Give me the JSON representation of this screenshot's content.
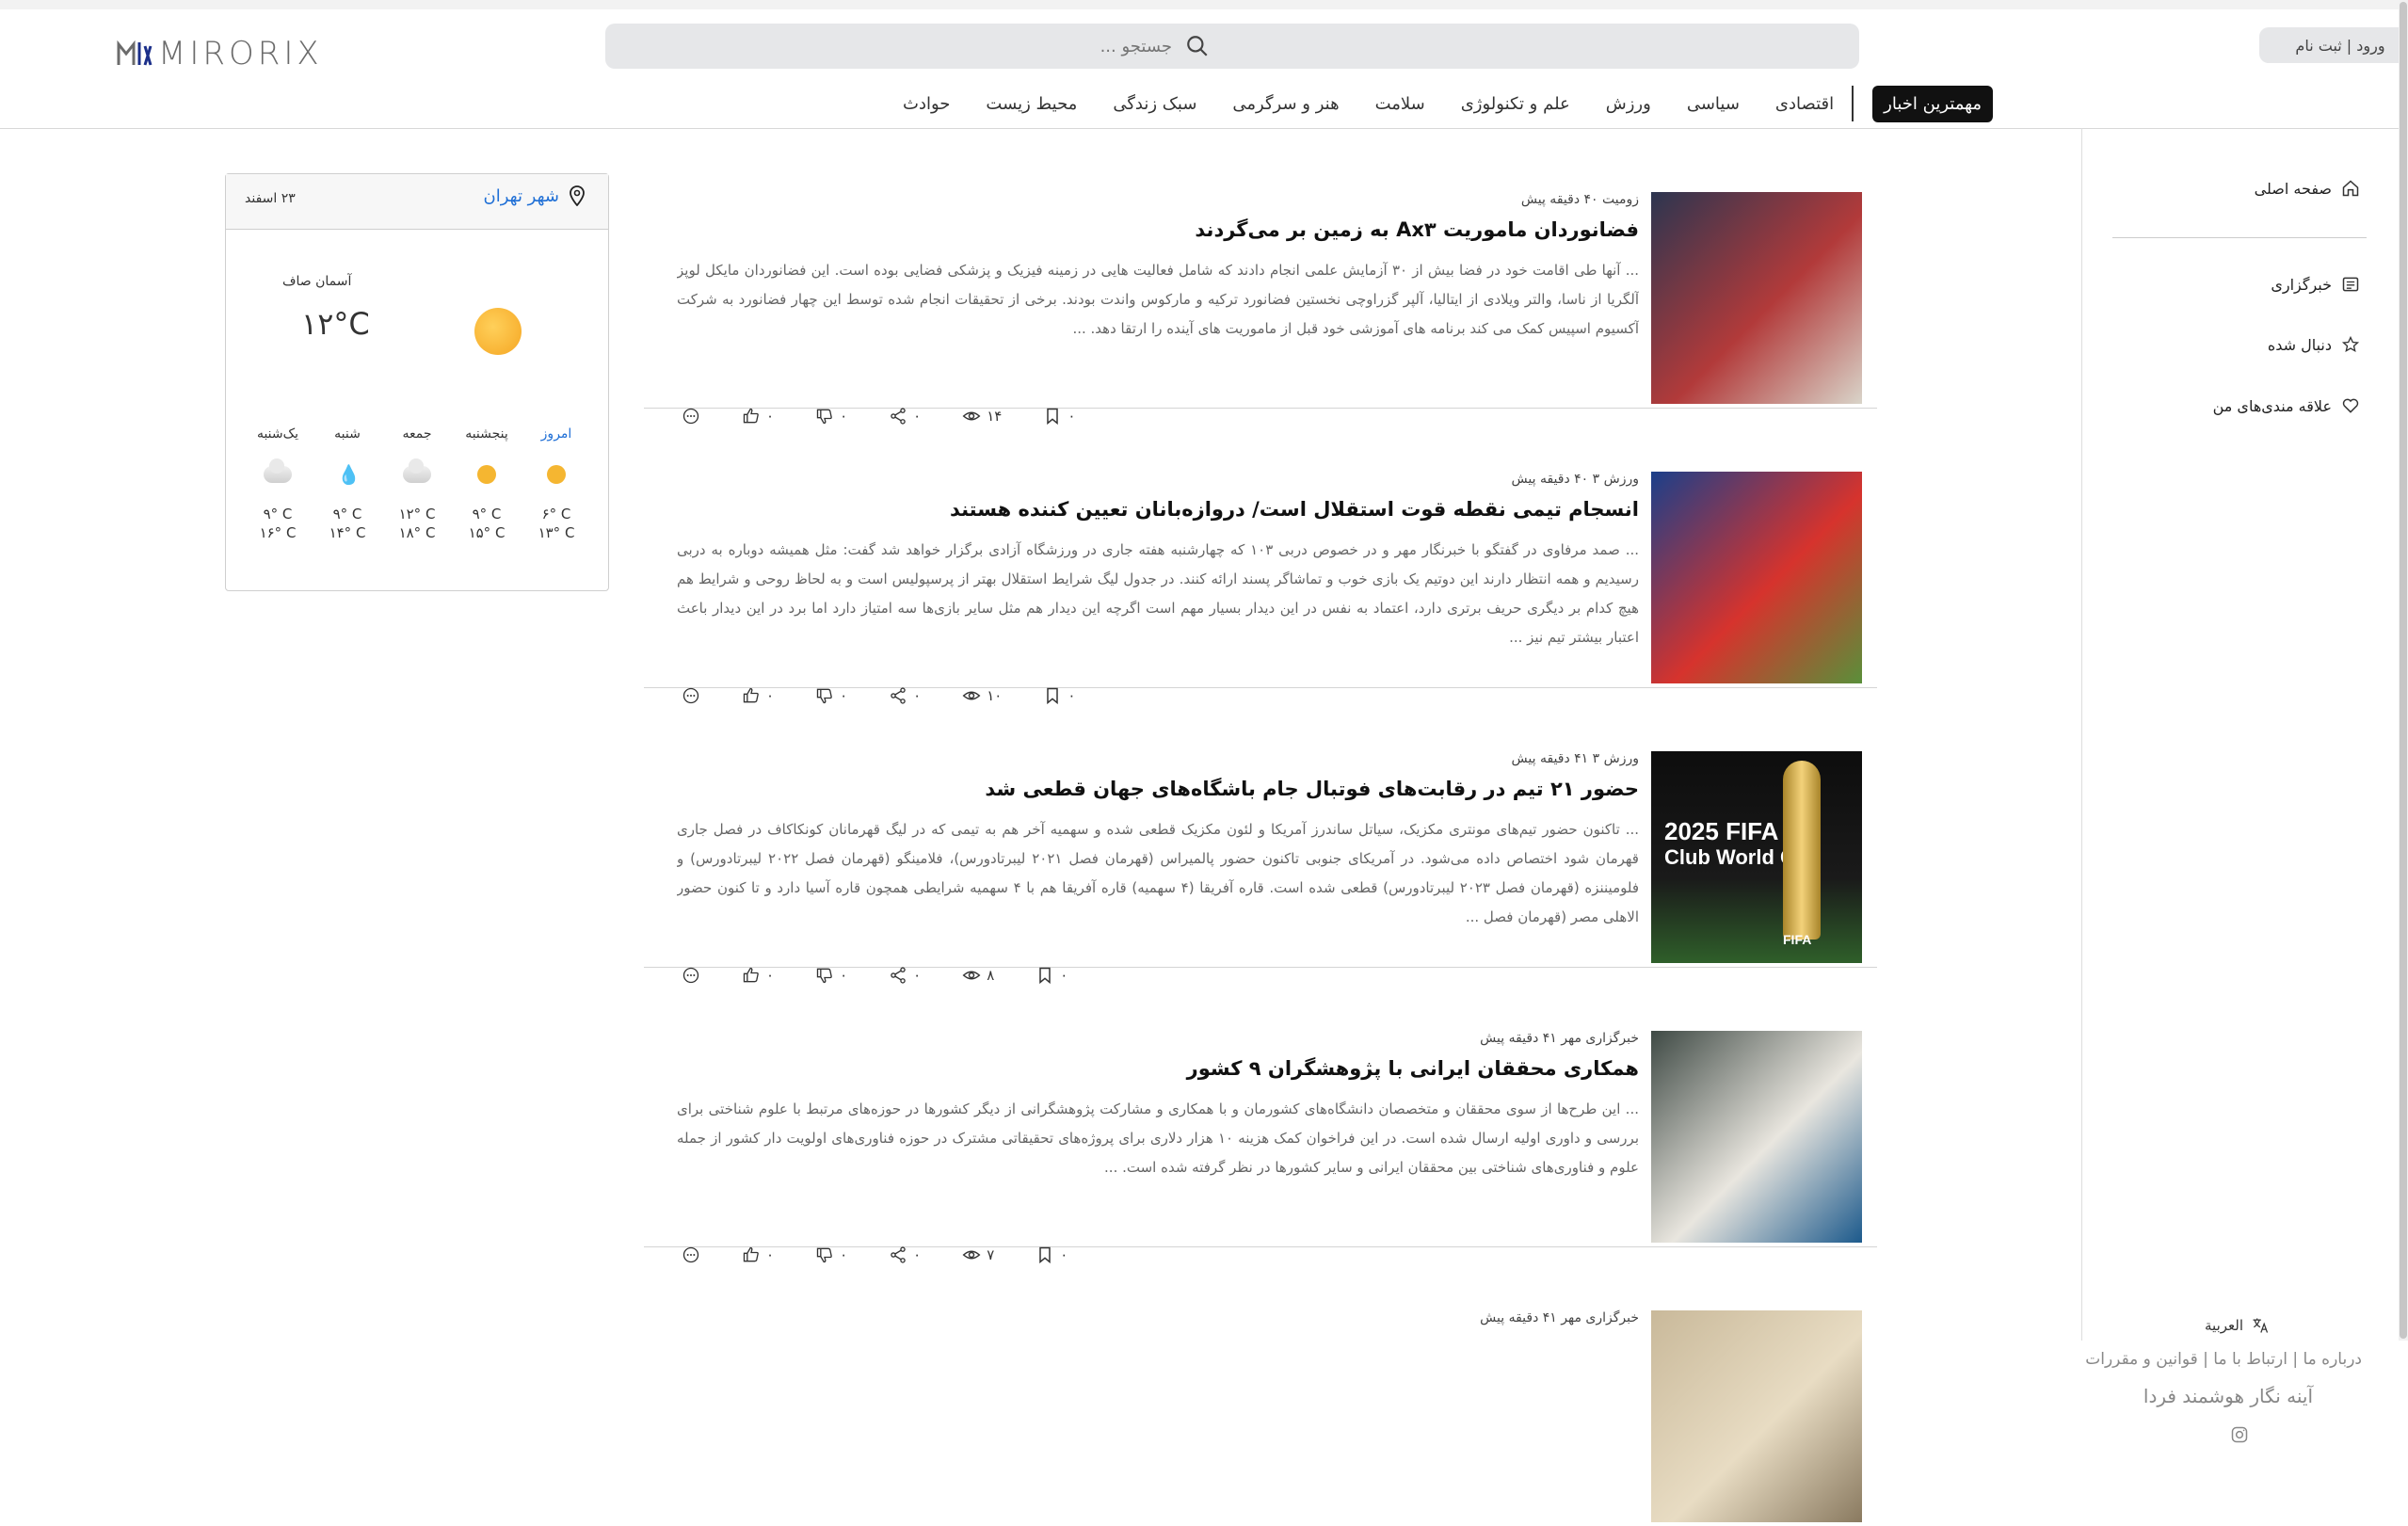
{
  "header": {
    "logo_text": "MIRORIX",
    "search_placeholder": "جستجو ...",
    "login_label": "ورود | ثبت نام",
    "nav": [
      {
        "label": "مهمترین اخبار",
        "active": true
      },
      {
        "label": "اقتصادی"
      },
      {
        "label": "سیاسی"
      },
      {
        "label": "ورزش"
      },
      {
        "label": "علم و تکنولوژی"
      },
      {
        "label": "سلامت"
      },
      {
        "label": "هنر و سرگرمی"
      },
      {
        "label": "سبک زندگی"
      },
      {
        "label": "محیط زیست"
      },
      {
        "label": "حوادث"
      }
    ]
  },
  "sidebar": {
    "home": "صفحه اصلی",
    "agency": "خبرگزاری",
    "followed": "دنبال شده",
    "favorites": "علاقه مندی‌های من",
    "lang": "العربية",
    "links": "درباره ما | ارتباط با ما | قوانین و مقررات",
    "brand": "آینه نگار هوشمند فردا"
  },
  "weather": {
    "city": "شهر تهران",
    "date": "۲۳ اسفند",
    "condition": "آسمان صاف",
    "temp": "۱۲°C",
    "forecast": [
      {
        "day": "امروز",
        "icon": "sun-icon",
        "max": "۶° C",
        "min": "۱۳° C"
      },
      {
        "day": "پنجشنبه",
        "icon": "sun-icon",
        "max": "۹° C",
        "min": "۱۵° C"
      },
      {
        "day": "جمعه",
        "icon": "cloud-icon",
        "max": "۱۲° C",
        "min": "۱۸° C"
      },
      {
        "day": "شنبه",
        "icon": "rain-icon",
        "max": "۹° C",
        "min": "۱۴° C"
      },
      {
        "day": "یک‌شنبه",
        "icon": "cloud-icon",
        "max": "۹° C",
        "min": "۱۶° C"
      }
    ]
  },
  "articles": [
    {
      "meta": "زومیت ۴۰ دقیقه پیش",
      "title": "فضانوردان ماموریت Ax۳ به زمین بر می‌گردند",
      "summary": "... آنها طی اقامت خود در فضا بیش از ۳۰ آزمایش علمی انجام دادند که شامل فعالیت هایی در زمینه فیزیک و پزشکی فضایی بوده است. این فضانوردان مایکل لوپز آلگریا از ناسا، والتر ویلادی از ایتالیا، آلپر گزراوچی نخستین فضانورد ترکیه و مارکوس واندت بودند. برخی از تحقیقات انجام شده توسط این چهار فضانورد به شرکت آکسیوم اسپیس کمک می کند برنامه های آموزشی خود قبل از ماموریت های آینده را ارتقا دهد. ...",
      "likes": "۰",
      "dislikes": "۰",
      "shares": "۰",
      "views": "۱۴",
      "saves": "۰",
      "thumb_colors": [
        "#2c3550",
        "#b23a3a",
        "#d9d4c9"
      ]
    },
    {
      "meta": "ورزش ۳ ۴۰ دقیقه پیش",
      "title": "انسجام تیمی نقطه قوت استقلال است/ دروازه‌بانان تعیین کننده هستند",
      "summary": "... صمد مرفاوی در گفتگو با خبرنگار مهر و در خصوص دربی ۱۰۳ که چهارشنبه هفته جاری در ورزشگاه آزادی برگزار خواهد شد گفت: مثل همیشه دوباره به دربی رسیدیم و همه انتظار دارند این دوتیم یک بازی خوب و تماشاگر پسند ارائه کنند. در جدول لیگ شرایط استقلال بهتر از پرسپولیس است و به لحاظ روحی و شرایط هم هیچ کدام بر دیگری حریف برتری دارد، اعتماد به نفس در این دیدار بسیار مهم است اگرچه این دیدار هم مثل سایر بازی‌ها سه امتیاز دارد اما برد در این دیدار باعث اعتبار بیشتر تیم نیز ...",
      "likes": "۰",
      "dislikes": "۰",
      "shares": "۰",
      "views": "۱۰",
      "saves": "۰",
      "thumb_colors": [
        "#1b3f8a",
        "#d6332d",
        "#5a8f3a"
      ]
    },
    {
      "meta": "ورزش ۳ ۴۱ دقیقه پیش",
      "title": "حضور ۲۱ تیم در رقابت‌های فوتبال جام باشگاه‌های جهان قطعی شد",
      "summary": "... تاکنون حضور تیم‌های مونتری مکزیک، سیاتل ساندرز آمریکا و لئون مکزیک قطعی شده و سهمیه آخر هم به تیمی که در لیگ قهرمانان کونکاکاف در فصل جاری قهرمان شود اختصاص داده می‌شود. در آمریکای جنوبی تاکنون حضور پالمیراس (قهرمان فصل ۲۰۲۱ لیبرتادورس)، فلامینگو (قهرمان فصل ۲۰۲۲ لیبرتادورس) و فلومیننزه (قهرمان فصل ۲۰۲۳ لیبرتادورس) قطعی شده است. قاره آفریقا (۴ سهمیه) قاره آفریقا هم با ۴ سهمیه شرایطی همچون قاره آسیا دارد و تا کنون حضور الاهلی مصر (قهرمان فصل ...",
      "likes": "۰",
      "dislikes": "۰",
      "shares": "۰",
      "views": "۸",
      "saves": "۰",
      "thumb_text_1": "2025 FIFA",
      "thumb_text_2": "Club World Cup",
      "thumb_text_3": "FIFA"
    },
    {
      "meta": "خبرگزاری مهر ۴۱ دقیقه پیش",
      "title": "همکاری محققان ایرانی با پژوهشگران ۹ کشور",
      "summary": "... این طرح‌ها از سوی محققان و متخصصان دانشگاه‌های کشورمان و با همکاری و مشارکت پژوهشگرانی از دیگر کشورها در حوزه‌های مرتبط با علوم شناختی برای بررسی و داوری اولیه ارسال شده است. در این فراخوان کمک هزینه ۱۰ هزار دلاری برای پروژه‌های تحقیقاتی مشترک در حوزه فناوری‌های اولویت دار کشور از جمله علوم و فناوری‌های شناختی بین محققان ایرانی و سایر کشورها در نظر گرفته شده است. ...",
      "likes": "۰",
      "dislikes": "۰",
      "shares": "۰",
      "views": "۷",
      "saves": "۰",
      "thumb_colors": [
        "#3f4a45",
        "#e9e6df",
        "#1d5a8c"
      ]
    },
    {
      "meta": "خبرگزاری مهر ۴۱ دقیقه پیش",
      "title": "",
      "summary": "",
      "thumb_colors": [
        "#c9b99a",
        "#e8dcc3",
        "#8a7a60"
      ]
    }
  ]
}
